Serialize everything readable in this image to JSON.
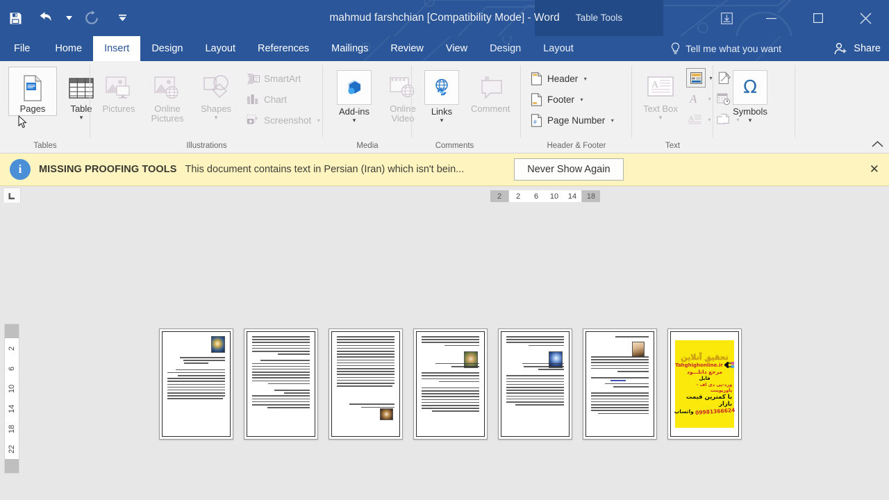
{
  "window": {
    "title": "mahmud farshchian [Compatibility Mode] - Word",
    "contextual_tools": "Table Tools",
    "accent_color": "#2b579a",
    "controls": [
      {
        "name": "ribbon-display-options",
        "glyph": "⤓"
      },
      {
        "name": "minimize",
        "glyph": "─"
      },
      {
        "name": "restore",
        "glyph": "□"
      },
      {
        "name": "close",
        "glyph": "✕"
      }
    ]
  },
  "quick_access": [
    {
      "name": "save",
      "glyph": "save-icon",
      "enabled": true
    },
    {
      "name": "undo",
      "glyph": "undo-icon",
      "enabled": true
    },
    {
      "name": "undo-dropdown",
      "glyph": "▾",
      "enabled": true
    },
    {
      "name": "redo",
      "glyph": "redo-icon",
      "enabled": false
    },
    {
      "name": "customize-quick-access-toolbar",
      "glyph": "⌄",
      "enabled": true
    }
  ],
  "tabs": {
    "items": [
      {
        "label": "File",
        "active": false,
        "contextual": false
      },
      {
        "label": "Home",
        "active": false,
        "contextual": false
      },
      {
        "label": "Insert",
        "active": true,
        "contextual": false
      },
      {
        "label": "Design",
        "active": false,
        "contextual": false
      },
      {
        "label": "Layout",
        "active": false,
        "contextual": false
      },
      {
        "label": "References",
        "active": false,
        "contextual": false
      },
      {
        "label": "Mailings",
        "active": false,
        "contextual": false
      },
      {
        "label": "Review",
        "active": false,
        "contextual": false
      },
      {
        "label": "View",
        "active": false,
        "contextual": false
      },
      {
        "label": "Design",
        "active": false,
        "contextual": true
      },
      {
        "label": "Layout",
        "active": false,
        "contextual": true
      }
    ],
    "tell_me": "Tell me what you want",
    "share": "Share"
  },
  "ribbon": {
    "collapse_tooltip": "∧",
    "groups": [
      {
        "label": "Tables",
        "items": [
          {
            "name": "pages",
            "label": "Pages",
            "caret": false,
            "enabled": true,
            "hovered": true,
            "icon": "pages-icon"
          },
          {
            "name": "table",
            "label": "Table",
            "caret": true,
            "enabled": true,
            "hovered": false,
            "icon": "table-icon"
          }
        ]
      },
      {
        "label": "Illustrations",
        "items": [
          {
            "name": "pictures",
            "label": "Pictures",
            "caret": false,
            "enabled": false,
            "icon": "pictures-icon"
          },
          {
            "name": "online-pictures",
            "label": "Online Pictures",
            "caret": false,
            "enabled": false,
            "icon": "online-pictures-icon"
          },
          {
            "name": "shapes",
            "label": "Shapes",
            "caret": true,
            "enabled": false,
            "icon": "shapes-icon"
          }
        ],
        "small_items": [
          {
            "name": "smartart",
            "label": "SmartArt",
            "enabled": false,
            "caret": false,
            "icon": "smartart-icon"
          },
          {
            "name": "chart",
            "label": "Chart",
            "enabled": false,
            "caret": false,
            "icon": "chart-icon"
          },
          {
            "name": "screenshot",
            "label": "Screenshot",
            "enabled": false,
            "caret": true,
            "icon": "screenshot-icon"
          }
        ]
      },
      {
        "label": "Media",
        "items": [
          {
            "name": "add-ins",
            "label": "Add-ins",
            "caret": true,
            "enabled": true,
            "icon": "add-ins-icon"
          },
          {
            "name": "online-video",
            "label": "Online Video",
            "caret": false,
            "enabled": false,
            "icon": "online-video-icon"
          }
        ]
      },
      {
        "label": "Comments",
        "items": [
          {
            "name": "links",
            "label": "Links",
            "caret": true,
            "enabled": true,
            "icon": "links-icon"
          },
          {
            "name": "comment",
            "label": "Comment",
            "caret": false,
            "enabled": false,
            "icon": "comment-icon"
          }
        ]
      },
      {
        "label": "Header & Footer",
        "small_items": [
          {
            "name": "header",
            "label": "Header",
            "enabled": true,
            "caret": true,
            "icon": "header-icon"
          },
          {
            "name": "footer",
            "label": "Footer",
            "enabled": true,
            "caret": true,
            "icon": "footer-icon"
          },
          {
            "name": "page-number",
            "label": "Page Number",
            "enabled": true,
            "caret": true,
            "icon": "page-number-icon"
          }
        ]
      },
      {
        "label": "Text",
        "items": [
          {
            "name": "text-box",
            "label": "Text Box",
            "caret": true,
            "enabled": false,
            "icon": "text-box-icon"
          }
        ],
        "mini_items": [
          {
            "name": "quick-parts",
            "enabled": true,
            "caret": true,
            "icon": "quick-parts-icon"
          },
          {
            "name": "signature-line",
            "enabled": true,
            "caret": true,
            "icon": "signature-line-icon"
          },
          {
            "name": "wordart",
            "enabled": false,
            "caret": true,
            "icon": "wordart-icon"
          },
          {
            "name": "date-and-time",
            "enabled": false,
            "caret": false,
            "icon": "date-time-icon"
          },
          {
            "name": "drop-cap",
            "enabled": false,
            "caret": true,
            "icon": "drop-cap-icon"
          },
          {
            "name": "object",
            "enabled": false,
            "caret": true,
            "icon": "object-icon"
          }
        ]
      },
      {
        "label": "",
        "items": [
          {
            "name": "symbols",
            "label": "Symbols",
            "caret": true,
            "enabled": true,
            "icon": "omega-icon",
            "glyph": "Ω"
          }
        ]
      }
    ]
  },
  "message_bar": {
    "icon": "info-icon",
    "title": "MISSING PROOFING TOOLS",
    "text": "This document contains text in Persian (Iran) which isn't bein...",
    "button": "Never Show Again",
    "close": "✕",
    "background": "#fdf4bf"
  },
  "rulers": {
    "tab_selector": "left-tab-stop-icon",
    "horizontal": [
      "2",
      "2",
      "6",
      "10",
      "14",
      "18"
    ],
    "vertical": [
      "2",
      "2",
      "6",
      "10",
      "14",
      "18",
      "22"
    ]
  },
  "document": {
    "zoom_view": "multiple-pages",
    "pages": [
      {
        "name": "page-1",
        "image": "img-a",
        "type": "text"
      },
      {
        "name": "page-2",
        "image": null,
        "type": "text"
      },
      {
        "name": "page-3",
        "image": "img-b",
        "type": "text"
      },
      {
        "name": "page-4",
        "image": "img-c",
        "type": "text"
      },
      {
        "name": "page-5",
        "image": "img-d",
        "type": "text"
      },
      {
        "name": "page-6",
        "image": "img-portrait",
        "type": "text-with-heading"
      },
      {
        "name": "page-7",
        "image": null,
        "type": "advertisement"
      }
    ],
    "advertisement": {
      "line1": "تحقیق آنلاین",
      "line2": "Tahghighonline.ir",
      "line3": "مرجع دانلـــود",
      "line4": "فایل",
      "line5": "ورد-پی دی اف - پاورپوینت",
      "line6": "با کمترین قیمت بازار",
      "line7_phone": "09981366624",
      "line7_label": "واتساپ",
      "background": "#fbe90b"
    }
  }
}
